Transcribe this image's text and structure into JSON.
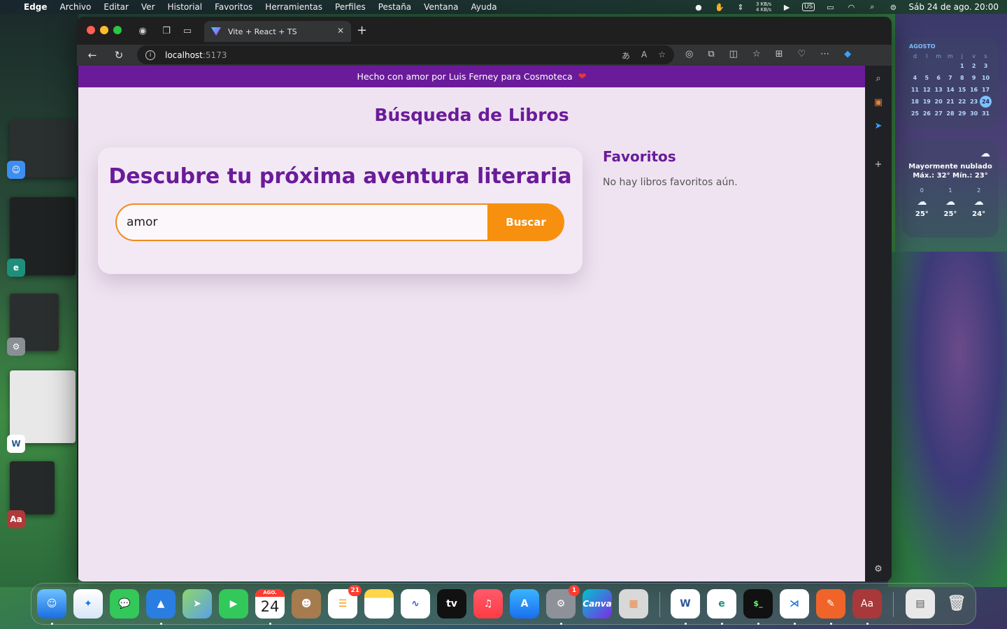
{
  "menubar": {
    "app_name": "Edge",
    "items": [
      "Archivo",
      "Editar",
      "Ver",
      "Historial",
      "Favoritos",
      "Herramientas",
      "Perfiles",
      "Pestaña",
      "Ventana",
      "Ayuda"
    ],
    "net_up": "3 KB/s",
    "net_down": "4 KB/s",
    "keyboard": "US",
    "datetime": "Sáb 24 de ago.  20:00"
  },
  "browser": {
    "tab_title": "Vite + React + TS",
    "url_host": "localhost",
    "url_port": ":5173"
  },
  "page": {
    "banner_text": "Hecho con amor por Luis Ferney para Cosmoteca",
    "title": "Búsqueda de Libros",
    "search_heading": "Descubre tu próxima aventura literaria",
    "search_value": "amor",
    "search_button": "Buscar",
    "favorites_title": "Favoritos",
    "favorites_empty": "No hay libros favoritos aún."
  },
  "calendar": {
    "month": "AGOSTO",
    "weekdays": [
      "d",
      "l",
      "m",
      "m",
      "j",
      "v",
      "s"
    ],
    "weeks": [
      [
        "",
        "",
        "",
        "",
        "1",
        "2",
        "3"
      ],
      [
        "4",
        "5",
        "6",
        "7",
        "8",
        "9",
        "10"
      ],
      [
        "11",
        "12",
        "13",
        "14",
        "15",
        "16",
        "17"
      ],
      [
        "18",
        "19",
        "20",
        "21",
        "22",
        "23",
        "24"
      ],
      [
        "25",
        "26",
        "27",
        "28",
        "29",
        "30",
        "31"
      ]
    ],
    "today": "24"
  },
  "weather": {
    "condition": "Mayormente nublado",
    "range": "Máx.: 32° Mín.: 23°",
    "hours": [
      {
        "hour": "0",
        "temp": "25°"
      },
      {
        "hour": "1",
        "temp": "25°"
      },
      {
        "hour": "2",
        "temp": "24°"
      }
    ]
  },
  "dock": {
    "calendar_month": "AGO.",
    "calendar_day": "24",
    "reminders_badge": "21",
    "settings_badge": "1",
    "canva_label": "Canva",
    "dictionary_label": "Aa",
    "word_label": "W",
    "tv_label": "tv"
  },
  "stage": {
    "dictionary_label": "Aa",
    "word_label": "W"
  }
}
